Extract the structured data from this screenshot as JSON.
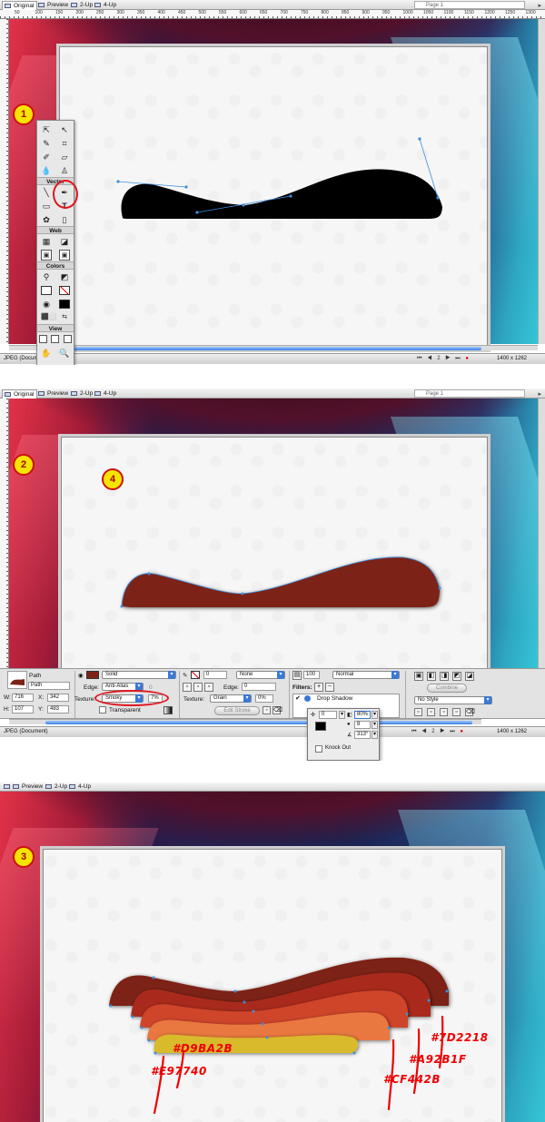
{
  "tabs": {
    "original": "Original",
    "preview": "Preview",
    "two_up": "2-Up",
    "four_up": "4-Up",
    "page": "Page 1"
  },
  "ruler_numbers": [
    "50",
    "100",
    "150",
    "200",
    "250",
    "300",
    "350",
    "400",
    "450",
    "500",
    "550",
    "600",
    "650",
    "700",
    "750",
    "800",
    "850",
    "900",
    "950",
    "1000",
    "1050",
    "1100",
    "1150",
    "1200",
    "1250",
    "1300"
  ],
  "status": {
    "doc": "JPEG (Document)",
    "page_index": "2",
    "dimensions": "1400 x 1262"
  },
  "steps": {
    "one": "1",
    "two": "2",
    "three": "3",
    "four": "4"
  },
  "toolbox": {
    "vector": "Vector",
    "web": "Web",
    "colors": "Colors",
    "view": "View",
    "text_tool": "T"
  },
  "property_inspector": {
    "object_type": "Path",
    "object_name": "Path",
    "w_label": "W:",
    "w": "716",
    "x_label": "X:",
    "x": "342",
    "h_label": "H:",
    "h": "107",
    "y_label": "Y:",
    "y": "483",
    "fill_type": "Solid",
    "edge_label": "Edge:",
    "edge": "Anti-Alias",
    "edge_value": "0",
    "texture_label": "Texture:",
    "texture": "Smoky",
    "texture_amount": "7%",
    "transparent": "Transparent",
    "stroke_size": "0",
    "stroke_type": "None",
    "stroke_edge_label": "Edge:",
    "stroke_edge": "0",
    "stroke_texture_label": "Texture:",
    "stroke_texture": "Grain",
    "stroke_texture_amount": "0%",
    "edit_stroke": "Edit Stroke",
    "opacity": "100",
    "blend": "Normal",
    "filters_label": "Filters:",
    "filter_item": "Drop Shadow",
    "combine": "Combine",
    "style": "No Style"
  },
  "shadow_popup": {
    "distance": "0",
    "opacity": "80%",
    "softness": "8",
    "angle": "313°",
    "knock_out": "Knock Out"
  },
  "hex_labels": {
    "c1": "#D9BA2B",
    "c2": "#E97740",
    "c3": "#CF442B",
    "c4": "#A92B1F",
    "c5": "#7D2218"
  },
  "colors": {
    "fill_step2": "#7d2218",
    "layer1": "#7D2218",
    "layer2": "#A92B1F",
    "layer3": "#CF442B",
    "layer4": "#E97740",
    "layer5": "#D9BA2B",
    "annotation": "#e00000",
    "selection": "#3a8fe0"
  },
  "icons": [
    "pointer-icon",
    "subselect-icon",
    "lasso-icon",
    "crop-icon",
    "brush-icon",
    "eraser-icon",
    "blur-icon",
    "stamp-icon",
    "pen-icon",
    "text-icon",
    "rectangle-icon",
    "knife-icon",
    "hotspot-icon",
    "slice-icon",
    "eyedropper-icon",
    "paint-bucket-icon",
    "hand-icon",
    "zoom-icon"
  ]
}
